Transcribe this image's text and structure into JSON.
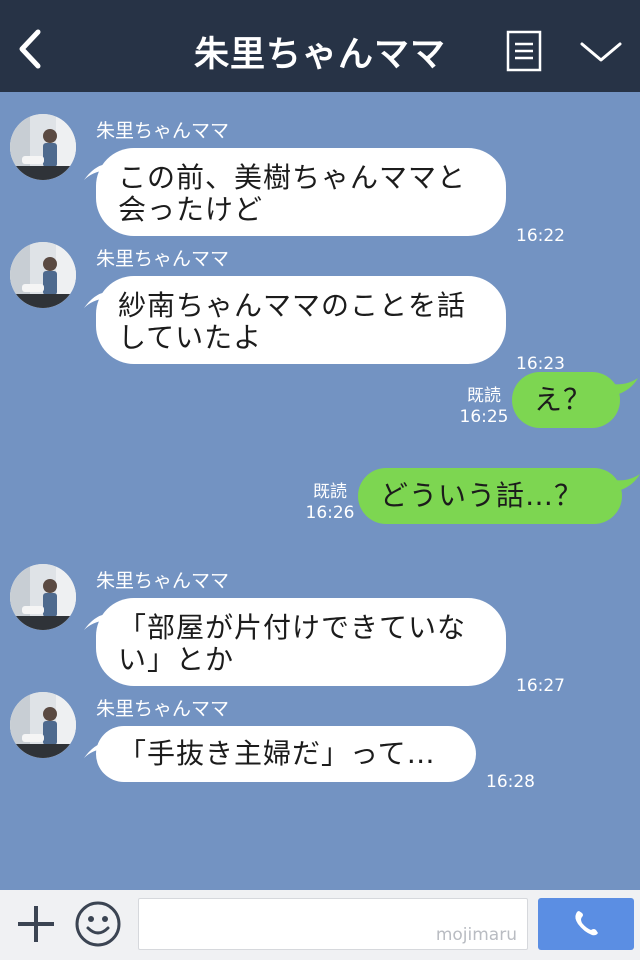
{
  "header": {
    "title": "朱里ちゃんママ",
    "back_icon": "chevron-left-icon",
    "menu_icon": "notes-icon",
    "collapse_icon": "chevron-down-icon",
    "background": "#273346"
  },
  "chat": {
    "background": "#7393c2",
    "messages": [
      {
        "direction": "in",
        "sender": "朱里ちゃんママ",
        "lines": [
          "この前、美樹ちゃんママと",
          "会ったけど"
        ],
        "time": "16:22"
      },
      {
        "direction": "in",
        "sender": "朱里ちゃんママ",
        "lines": [
          "紗南ちゃんママのことを話",
          "していたよ"
        ],
        "time": "16:23"
      },
      {
        "direction": "out",
        "read": "既読",
        "time": "16:25",
        "text": "え？"
      },
      {
        "direction": "out",
        "read": "既読",
        "time": "16:26",
        "text": "どういう話…？"
      },
      {
        "direction": "in",
        "sender": "朱里ちゃんママ",
        "lines": [
          "「部屋が片付けできていな",
          "い」とか"
        ],
        "time": "16:27"
      },
      {
        "direction": "in",
        "sender": "朱里ちゃんママ",
        "lines": [
          "「手抜き主婦だ」って…"
        ],
        "time": "16:28"
      }
    ]
  },
  "input_bar": {
    "plus_icon": "plus-icon",
    "emoji_icon": "smiley-icon",
    "placeholder": "",
    "watermark": "mojimaru",
    "call_icon": "phone-icon",
    "call_color": "#5b8ee3"
  },
  "colors": {
    "incoming_bubble": "#ffffff",
    "outgoing_bubble": "#7dd651"
  }
}
